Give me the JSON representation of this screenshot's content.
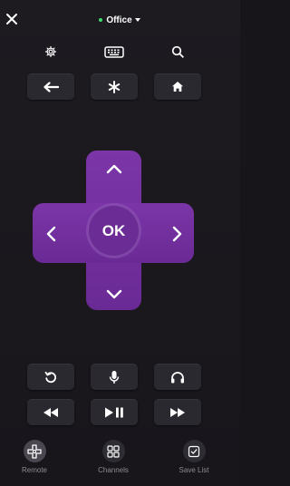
{
  "header": {
    "device_name": "Office",
    "status_color": "#3ddc6a"
  },
  "icons": {
    "close": "close-icon",
    "settings": "gear-icon",
    "keyboard": "keyboard-icon",
    "search": "search-icon",
    "back": "back-arrow-icon",
    "options": "asterisk-icon",
    "home": "home-icon",
    "replay": "replay-icon",
    "voice": "microphone-icon",
    "private_listening": "headphones-icon",
    "rewind": "rewind-icon",
    "play_pause": "play-pause-icon",
    "fast_forward": "fast-forward-icon"
  },
  "dpad": {
    "ok_label": "OK",
    "accent_color": "#6f2da1"
  },
  "nav": {
    "items": [
      {
        "label": "Remote",
        "icon": "remote-icon",
        "active": true
      },
      {
        "label": "Channels",
        "icon": "channels-grid-icon",
        "active": false
      },
      {
        "label": "Save List",
        "icon": "save-list-icon",
        "active": false
      }
    ]
  }
}
